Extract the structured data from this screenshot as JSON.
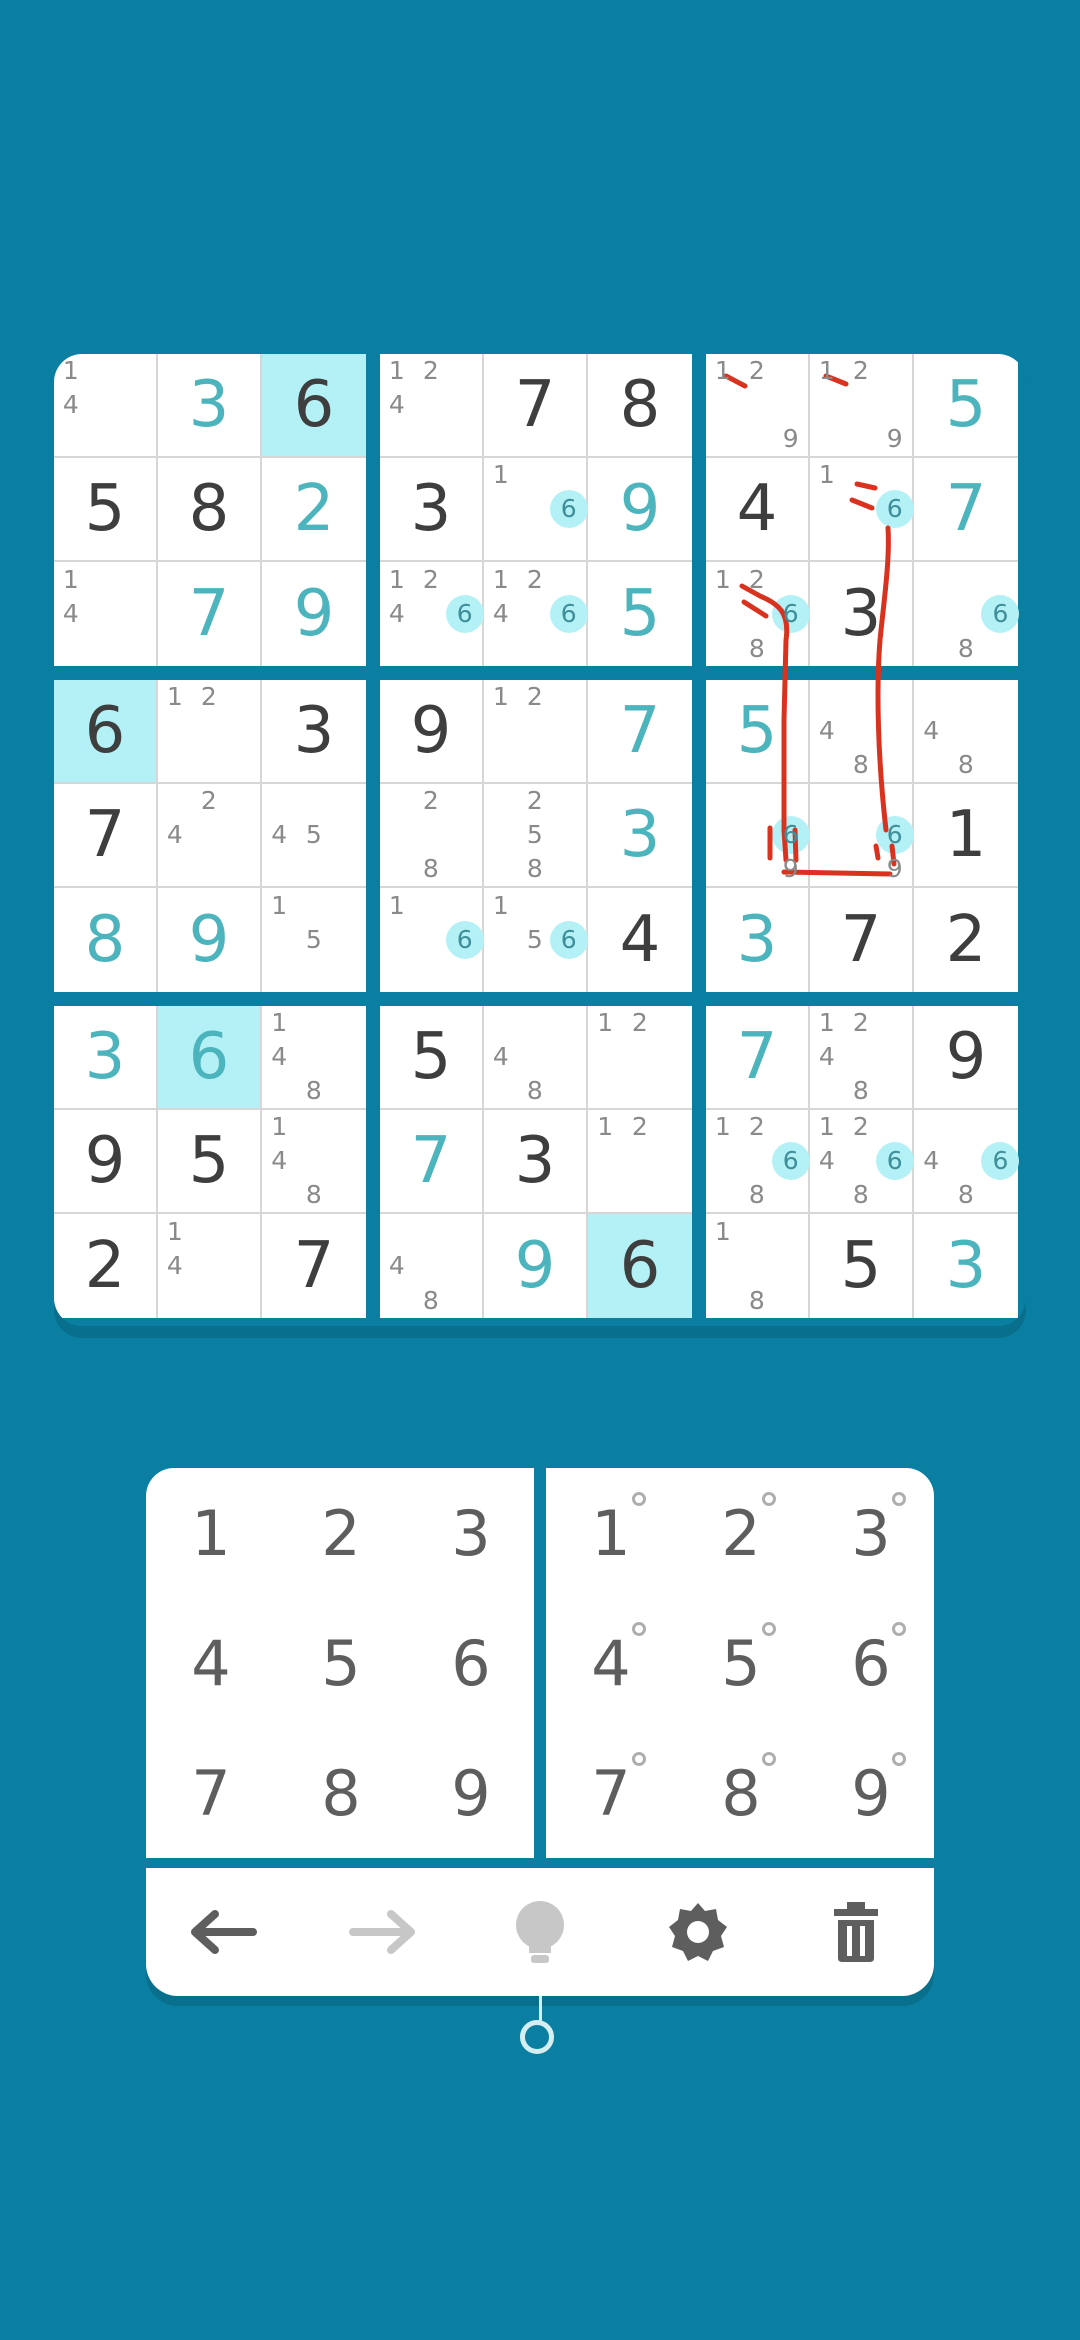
{
  "board": {
    "grid": [
      [
        null,
        3,
        6,
        null,
        7,
        8,
        null,
        null,
        5
      ],
      [
        5,
        8,
        2,
        3,
        null,
        9,
        4,
        null,
        7
      ],
      [
        null,
        7,
        9,
        null,
        null,
        5,
        null,
        3,
        null
      ],
      [
        6,
        null,
        3,
        9,
        null,
        7,
        5,
        null,
        null
      ],
      [
        7,
        null,
        null,
        null,
        null,
        3,
        null,
        null,
        1
      ],
      [
        8,
        9,
        null,
        null,
        null,
        4,
        3,
        7,
        2
      ],
      [
        3,
        6,
        null,
        5,
        null,
        null,
        7,
        null,
        9
      ],
      [
        9,
        5,
        null,
        7,
        3,
        null,
        null,
        null,
        null
      ],
      [
        2,
        null,
        7,
        null,
        9,
        6,
        null,
        5,
        3
      ]
    ],
    "user_entered": [
      [
        0,
        1,
        0,
        0,
        0,
        0,
        0,
        0,
        1
      ],
      [
        0,
        0,
        1,
        0,
        0,
        1,
        0,
        0,
        1
      ],
      [
        0,
        1,
        1,
        0,
        0,
        1,
        0,
        0,
        0
      ],
      [
        0,
        0,
        0,
        0,
        0,
        1,
        1,
        0,
        0
      ],
      [
        0,
        0,
        0,
        0,
        0,
        1,
        0,
        0,
        0
      ],
      [
        1,
        1,
        0,
        0,
        0,
        0,
        1,
        0,
        0
      ],
      [
        1,
        1,
        0,
        0,
        0,
        0,
        1,
        0,
        0
      ],
      [
        0,
        0,
        0,
        1,
        0,
        0,
        0,
        0,
        0
      ],
      [
        0,
        0,
        0,
        0,
        1,
        0,
        0,
        0,
        1
      ]
    ],
    "highlighted_cells": [
      [
        0,
        2
      ],
      [
        3,
        0
      ],
      [
        6,
        1
      ],
      [
        8,
        5
      ]
    ],
    "notes": [
      [
        [
          1,
          4
        ],
        null,
        null,
        [
          1,
          2,
          4
        ],
        null,
        null,
        [
          1,
          2,
          9
        ],
        [
          1,
          2,
          9
        ],
        null
      ],
      [
        null,
        null,
        null,
        null,
        [
          1,
          6
        ],
        null,
        null,
        [
          1,
          6
        ],
        null
      ],
      [
        [
          1,
          4
        ],
        null,
        null,
        [
          1,
          2,
          4,
          6
        ],
        [
          1,
          2,
          4,
          6
        ],
        null,
        [
          1,
          2,
          6,
          8
        ],
        null,
        [
          6,
          8
        ]
      ],
      [
        null,
        [
          1,
          2
        ],
        null,
        null,
        [
          1,
          2
        ],
        null,
        null,
        [
          4,
          8
        ],
        [
          4,
          8
        ]
      ],
      [
        null,
        [
          2,
          4
        ],
        [
          4,
          5
        ],
        [
          2,
          8
        ],
        [
          2,
          5,
          8
        ],
        null,
        [
          6,
          9
        ],
        [
          6,
          9
        ],
        null
      ],
      [
        null,
        null,
        [
          1,
          5
        ],
        [
          1,
          6
        ],
        [
          1,
          5,
          6
        ],
        null,
        null,
        null,
        null
      ],
      [
        null,
        null,
        [
          1,
          4,
          8
        ],
        null,
        [
          4,
          8
        ],
        [
          1,
          2
        ],
        null,
        [
          1,
          2,
          4,
          8
        ],
        null
      ],
      [
        null,
        null,
        [
          1,
          4,
          8
        ],
        null,
        null,
        [
          1,
          2
        ],
        [
          1,
          2,
          6,
          8
        ],
        [
          1,
          2,
          4,
          6,
          8
        ],
        [
          4,
          6,
          8
        ]
      ],
      [
        null,
        [
          1,
          4
        ],
        null,
        [
          4,
          8
        ],
        null,
        null,
        [
          1,
          8
        ],
        null,
        null
      ]
    ],
    "highlighted_note": 6
  },
  "number_pad": {
    "values": [
      "1",
      "2",
      "3",
      "4",
      "5",
      "6",
      "7",
      "8",
      "9"
    ],
    "notes": [
      "1",
      "2",
      "3",
      "4",
      "5",
      "6",
      "7",
      "8",
      "9"
    ]
  },
  "toolbar": {
    "items": [
      {
        "name": "undo-icon",
        "enabled": true
      },
      {
        "name": "redo-icon",
        "enabled": false
      },
      {
        "name": "hint-lightbulb-icon",
        "enabled": false
      },
      {
        "name": "settings-gear-icon",
        "enabled": true
      },
      {
        "name": "trash-icon",
        "enabled": true
      }
    ]
  },
  "colors": {
    "background": "#0A7FA1",
    "given_digit": "#3E3E3E",
    "user_digit": "#4BB4BD",
    "cell_highlight": "#B4F1F6",
    "note": "#8A8A8A",
    "pen_annotation": "#D9321F"
  }
}
